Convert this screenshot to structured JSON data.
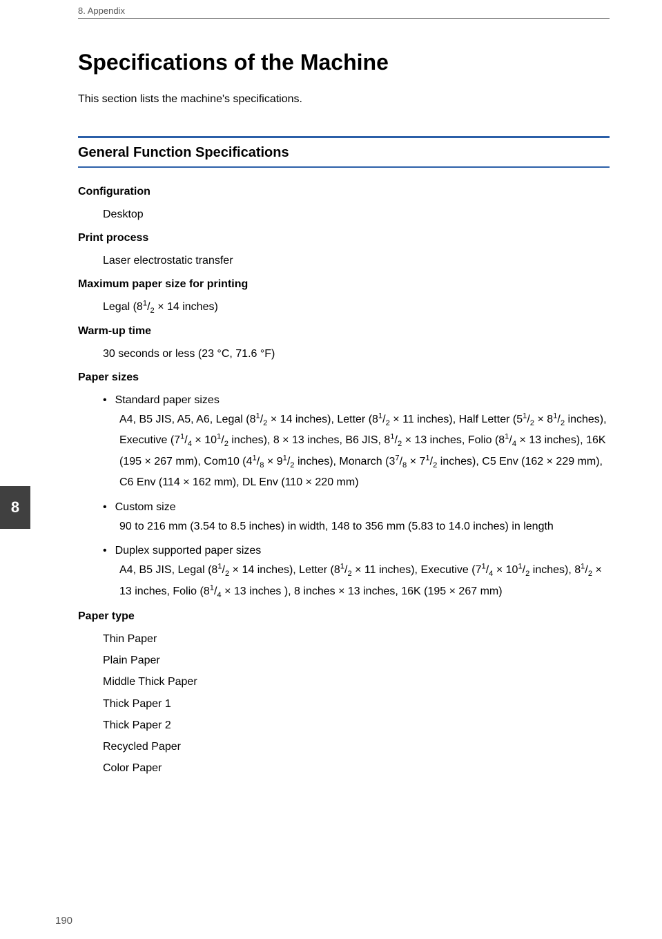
{
  "header": {
    "chapter": "8. Appendix"
  },
  "sideTab": "8",
  "pageNumber": "190",
  "title": "Specifications of the Machine",
  "intro": "This section lists the machine's specifications.",
  "sectionTitle": "General Function Specifications",
  "specs": {
    "configuration": {
      "label": "Configuration",
      "value": "Desktop"
    },
    "printProcess": {
      "label": "Print process",
      "value": "Laser electrostatic transfer"
    },
    "maxPaperSize": {
      "label": "Maximum paper size for printing"
    },
    "warmUp": {
      "label": "Warm-up time",
      "value": "30 seconds or less (23 °C, 71.6 °F)"
    },
    "paperSizes": {
      "label": "Paper sizes",
      "bullets": {
        "standard": "Standard paper sizes",
        "custom": "Custom size",
        "customValue": "90 to 216 mm (3.54 to 8.5 inches) in width, 148 to 356 mm (5.83 to 14.0 inches) in length",
        "duplex": "Duplex supported paper sizes"
      }
    },
    "paperType": {
      "label": "Paper type",
      "values": [
        "Thin Paper",
        "Plain Paper",
        "Middle Thick Paper",
        "Thick Paper 1",
        "Thick Paper 2",
        "Recycled Paper",
        "Color Paper"
      ]
    }
  },
  "chart_data": {
    "type": "table",
    "title": "General Function Specifications",
    "rows": [
      {
        "spec": "Configuration",
        "value": "Desktop"
      },
      {
        "spec": "Print process",
        "value": "Laser electrostatic transfer"
      },
      {
        "spec": "Maximum paper size for printing",
        "value": "Legal (8 1/2 × 14 inches)"
      },
      {
        "spec": "Warm-up time",
        "value": "30 seconds or less (23 °C, 71.6 °F)"
      },
      {
        "spec": "Paper sizes — Standard paper sizes",
        "value": "A4, B5 JIS, A5, A6, Legal (8 1/2 × 14 inches), Letter (8 1/2 × 11 inches), Half Letter (5 1/2 × 8 1/2 inches), Executive (7 1/4 × 10 1/2 inches), 8 × 13 inches, B6 JIS, 8 1/2 × 13 inches, Folio (8 1/4 × 13 inches), 16K (195 × 267 mm), Com10 (4 1/8 × 9 1/2 inches), Monarch (3 7/8 × 7 1/2 inches), C5 Env (162 × 229 mm), C6 Env (114 × 162 mm), DL Env (110 × 220 mm)"
      },
      {
        "spec": "Paper sizes — Custom size",
        "value": "90 to 216 mm (3.54 to 8.5 inches) in width, 148 to 356 mm (5.83 to 14.0 inches) in length"
      },
      {
        "spec": "Paper sizes — Duplex supported paper sizes",
        "value": "A4, B5 JIS, Legal (8 1/2 × 14 inches), Letter (8 1/2 × 11 inches), Executive (7 1/4 × 10 1/2 inches), 8 1/2 × 13 inches, Folio (8 1/4 × 13 inches), 8 inches × 13 inches, 16K (195 × 267 mm)"
      },
      {
        "spec": "Paper type",
        "value": "Thin Paper, Plain Paper, Middle Thick Paper, Thick Paper 1, Thick Paper 2, Recycled Paper, Color Paper"
      }
    ]
  }
}
